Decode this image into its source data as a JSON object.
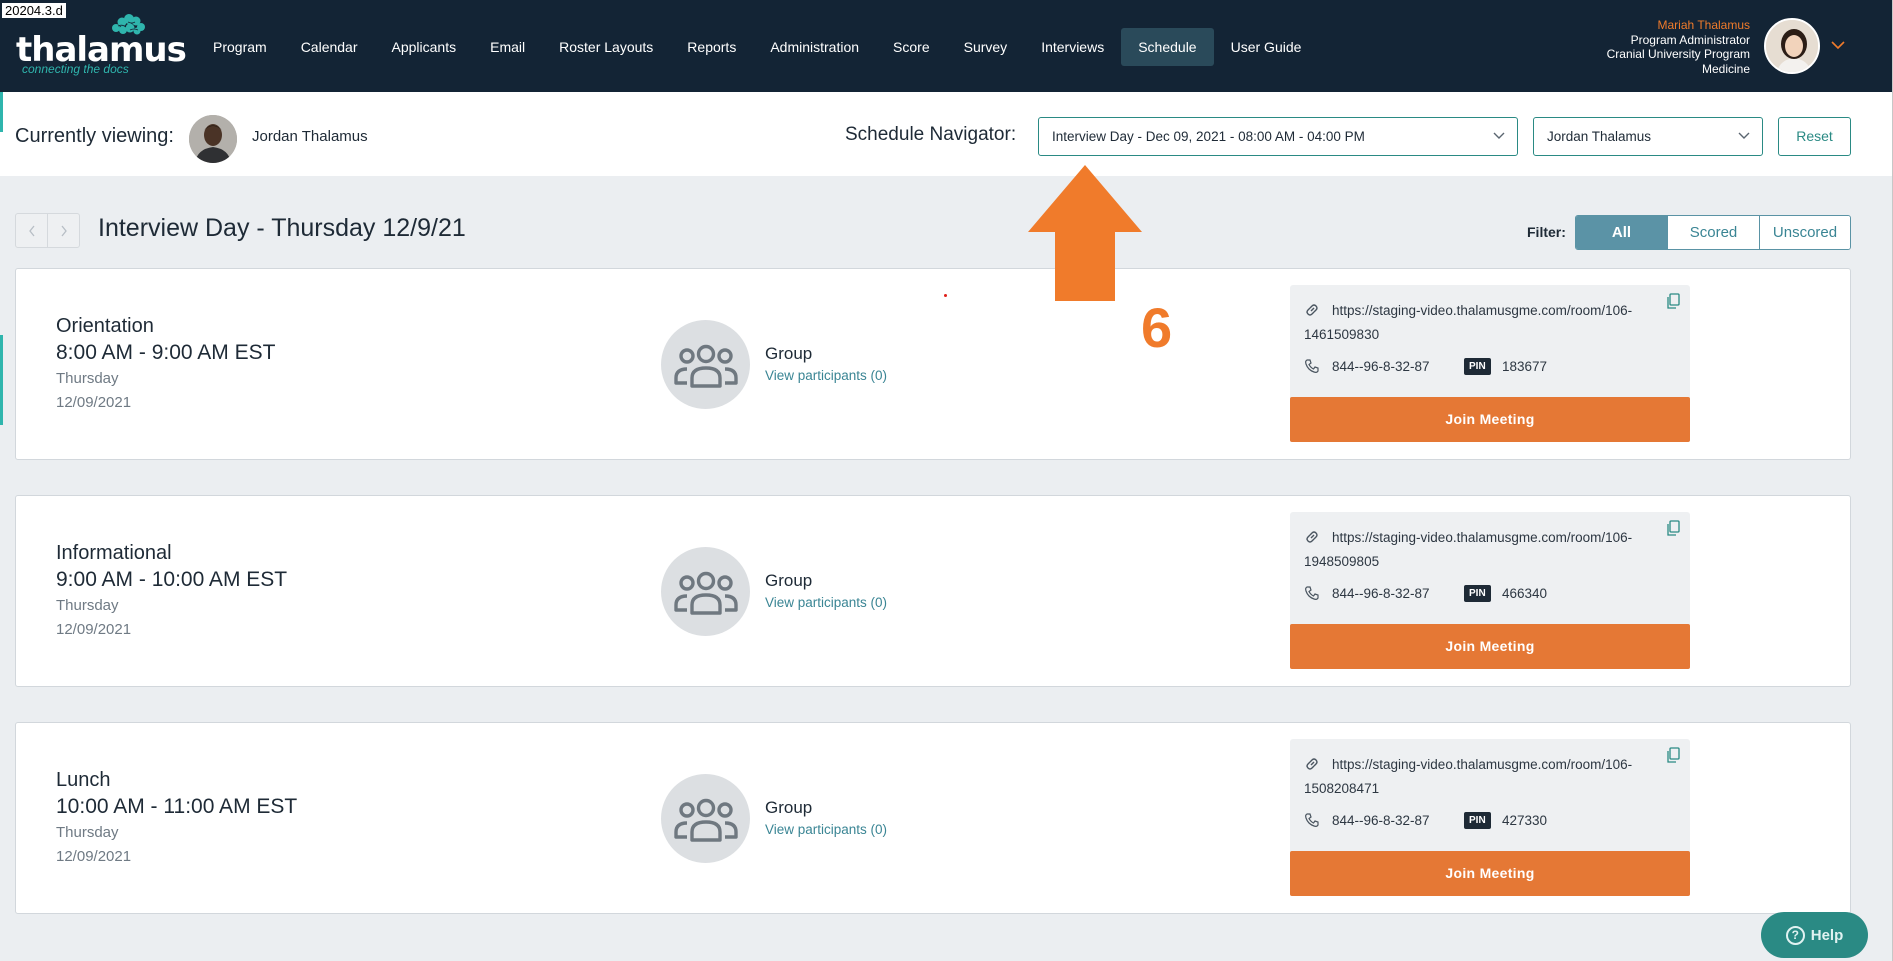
{
  "doc_tag": "20204.3.d",
  "brand": {
    "name": "thalamus",
    "tagline": "connecting the docs"
  },
  "nav": {
    "items": [
      {
        "label": "Program"
      },
      {
        "label": "Calendar"
      },
      {
        "label": "Applicants"
      },
      {
        "label": "Email"
      },
      {
        "label": "Roster Layouts"
      },
      {
        "label": "Reports"
      },
      {
        "label": "Administration"
      },
      {
        "label": "Score"
      },
      {
        "label": "Survey"
      },
      {
        "label": "Interviews"
      },
      {
        "label": "Schedule",
        "active": true
      },
      {
        "label": "User Guide"
      }
    ]
  },
  "user": {
    "name": "Mariah Thalamus",
    "role": "Program Administrator",
    "org_line1": "Cranial University Program",
    "org_line2": "Medicine"
  },
  "viewing": {
    "label": "Currently viewing:",
    "name": "Jordan Thalamus",
    "navigator_label": "Schedule Navigator:",
    "day_select": "Interview Day - Dec 09, 2021 - 08:00 AM - 04:00 PM",
    "person_select": "Jordan Thalamus",
    "reset": "Reset"
  },
  "schedule": {
    "title": "Interview Day - Thursday 12/9/21",
    "filter_label": "Filter:",
    "filters": [
      "All",
      "Scored",
      "Unscored"
    ],
    "active_filter": "All"
  },
  "events": [
    {
      "name": "Orientation",
      "time": "8:00 AM - 9:00 AM EST",
      "day": "Thursday",
      "date": "12/09/2021",
      "group_label": "Group",
      "participants_link": "View participants (0)",
      "url": "https://staging-video.thalamusgme.com/room/106-1461509830",
      "phone": "844--96-8-32-87",
      "pin_label": "PIN",
      "pin": "183677",
      "join": "Join Meeting"
    },
    {
      "name": "Informational",
      "time": "9:00 AM - 10:00 AM EST",
      "day": "Thursday",
      "date": "12/09/2021",
      "group_label": "Group",
      "participants_link": "View participants (0)",
      "url": "https://staging-video.thalamusgme.com/room/106-1948509805",
      "phone": "844--96-8-32-87",
      "pin_label": "PIN",
      "pin": "466340",
      "join": "Join Meeting"
    },
    {
      "name": "Lunch",
      "time": "10:00 AM - 11:00 AM EST",
      "day": "Thursday",
      "date": "12/09/2021",
      "group_label": "Group",
      "participants_link": "View participants (0)",
      "url": "https://staging-video.thalamusgme.com/room/106-1508208471",
      "phone": "844--96-8-32-87",
      "pin_label": "PIN",
      "pin": "427330",
      "join": "Join Meeting"
    }
  ],
  "annotation": {
    "number": "6"
  },
  "help": {
    "label": "Help"
  },
  "colors": {
    "nav_bg": "#132435",
    "accent_teal": "#2a8a84",
    "join_orange": "#e57835",
    "annotation_orange": "#f07b2b"
  }
}
